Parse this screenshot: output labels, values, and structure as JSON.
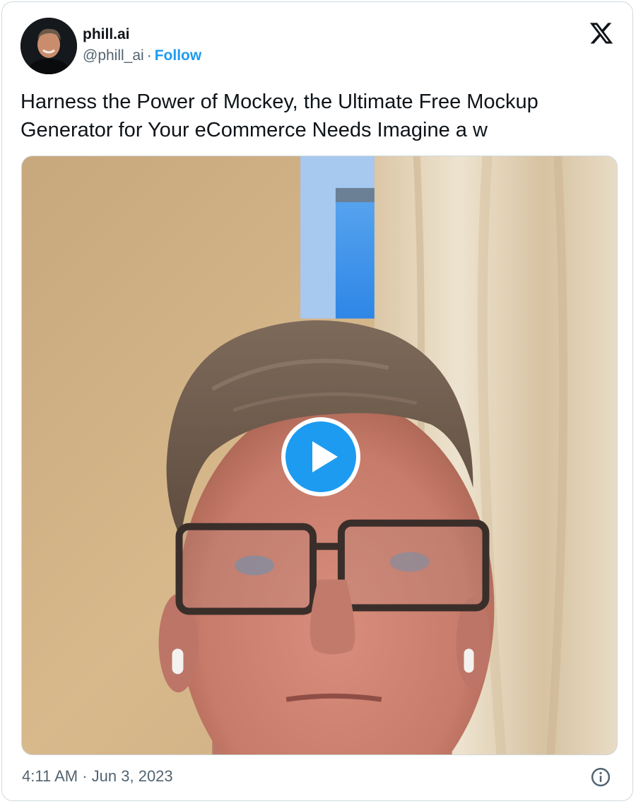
{
  "author": {
    "display_name": "phill.ai",
    "handle": "@phill_ai",
    "separator": "·",
    "follow_label": "Follow",
    "avatar_icon": "profile-photo"
  },
  "brand": {
    "logo_icon": "x-logo-icon"
  },
  "tweet": {
    "text": "Harness the Power of Mockey, the Ultimate Free Mockup Generator for Your eCommerce Needs Imagine a w"
  },
  "media": {
    "type": "video",
    "play_icon": "play-icon",
    "play_color": "#1d9bf0"
  },
  "footer": {
    "time": "4:11 AM",
    "separator": "·",
    "date": "Jun 3, 2023",
    "info_icon": "info-icon"
  },
  "colors": {
    "accent": "#1d9bf0",
    "text_primary": "#0f1419",
    "text_secondary": "#536471",
    "border": "#cfd9de"
  }
}
